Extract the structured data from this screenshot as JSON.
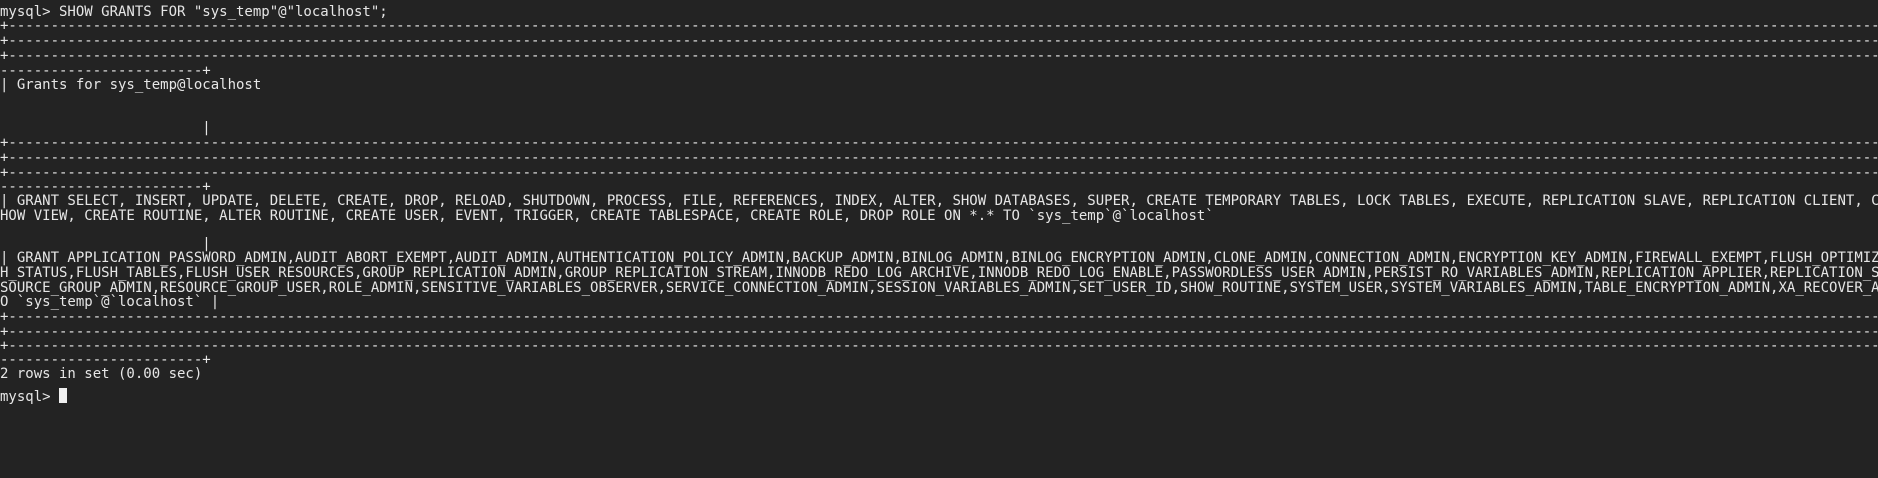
{
  "theme": {
    "background": "#232323",
    "foreground": "#e6e6e6",
    "cursor": "#f0f0f0"
  },
  "terminal": {
    "command_line": "mysql> SHOW GRANTS FOR \"sys_temp\"@\"localhost\";",
    "dash_line": "+---------------------------------------------------------------------------------------------------------------------------------------------------------------------------------------------------------------------------------------------------------------------------------------------",
    "dash_line_tail": "------------------------+",
    "header_cell": "| Grants for sys_temp@localhost",
    "header_pipe": "                        |",
    "row1_line1": "| GRANT SELECT, INSERT, UPDATE, DELETE, CREATE, DROP, RELOAD, SHUTDOWN, PROCESS, FILE, REFERENCES, INDEX, ALTER, SHOW DATABASES, SUPER, CREATE TEMPORARY TABLES, LOCK TABLES, EXECUTE, REPLICATION SLAVE, REPLICATION CLIENT, CREATE VIEW, S",
    "row1_line2": "HOW VIEW, CREATE ROUTINE, ALTER ROUTINE, CREATE USER, EVENT, TRIGGER, CREATE TABLESPACE, CREATE ROLE, DROP ROLE ON *.* TO `sys_temp`@`localhost`",
    "row1_pipe": "                        |",
    "row2_line1": "| GRANT APPLICATION_PASSWORD_ADMIN,AUDIT_ABORT_EXEMPT,AUDIT_ADMIN,AUTHENTICATION_POLICY_ADMIN,BACKUP_ADMIN,BINLOG_ADMIN,BINLOG_ENCRYPTION_ADMIN,CLONE_ADMIN,CONNECTION_ADMIN,ENCRYPTION_KEY_ADMIN,FIREWALL_EXEMPT,FLUSH_OPTIMIZER_COSTS,FLUS",
    "row2_line2": "H_STATUS,FLUSH_TABLES,FLUSH_USER_RESOURCES,GROUP_REPLICATION_ADMIN,GROUP_REPLICATION_STREAM,INNODB_REDO_LOG_ARCHIVE,INNODB_REDO_LOG_ENABLE,PASSWORDLESS_USER_ADMIN,PERSIST_RO_VARIABLES_ADMIN,REPLICATION_APPLIER,REPLICATION_SLAVE_ADMIN,RE",
    "row2_line3": "SOURCE_GROUP_ADMIN,RESOURCE_GROUP_USER,ROLE_ADMIN,SENSITIVE_VARIABLES_OBSERVER,SERVICE_CONNECTION_ADMIN,SESSION_VARIABLES_ADMIN,SET_USER_ID,SHOW_ROUTINE,SYSTEM_USER,SYSTEM_VARIABLES_ADMIN,TABLE_ENCRYPTION_ADMIN,XA_RECOVER_ADMIN ON *.* T",
    "row2_line4": "O `sys_temp`@`localhost` |",
    "result_summary": "2 rows in set (0.00 sec)",
    "prompt": "mysql> "
  }
}
